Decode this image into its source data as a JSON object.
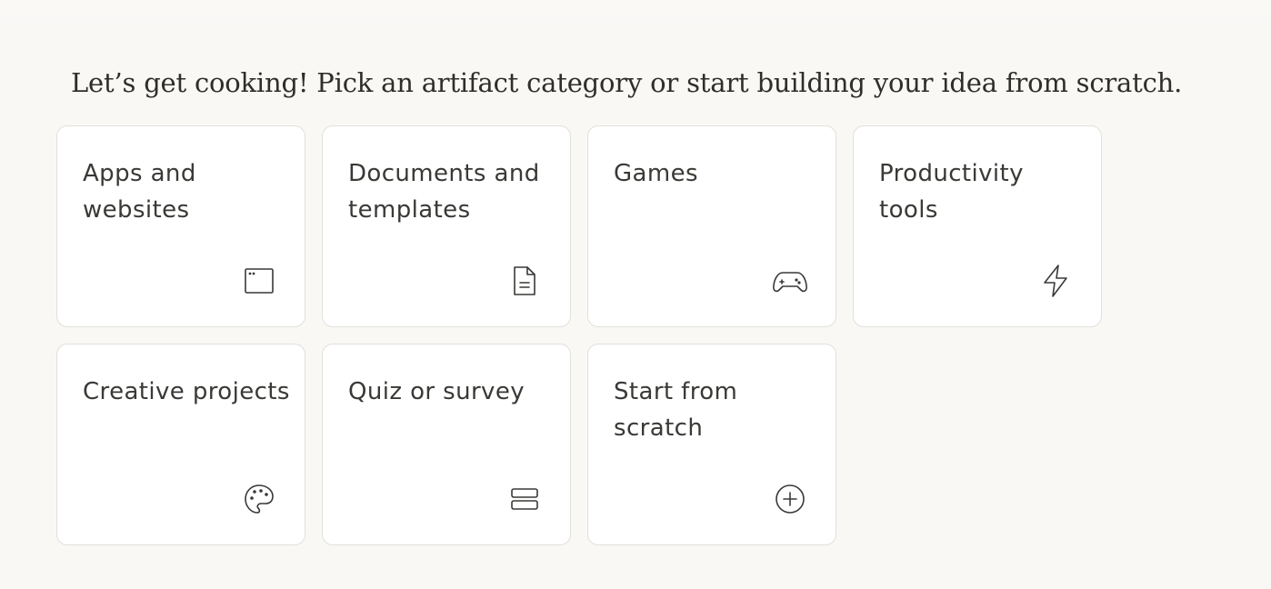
{
  "page": {
    "headline": "Let’s get cooking! Pick an artifact category or start building your idea from scratch."
  },
  "categories": [
    {
      "label": "Apps and websites",
      "icon": "app-window-icon"
    },
    {
      "label": "Documents and templates",
      "icon": "document-icon"
    },
    {
      "label": "Games",
      "icon": "gamepad-icon"
    },
    {
      "label": "Productivity tools",
      "icon": "lightning-icon"
    },
    {
      "label": "Creative projects",
      "icon": "palette-icon"
    },
    {
      "label": "Quiz or survey",
      "icon": "stacked-rows-icon"
    },
    {
      "label": "Start from scratch",
      "icon": "plus-circle-icon"
    }
  ],
  "colors": {
    "background": "#f9f8f5",
    "card_background": "#ffffff",
    "card_border": "#e2e0db",
    "text": "#2f2e2b"
  }
}
